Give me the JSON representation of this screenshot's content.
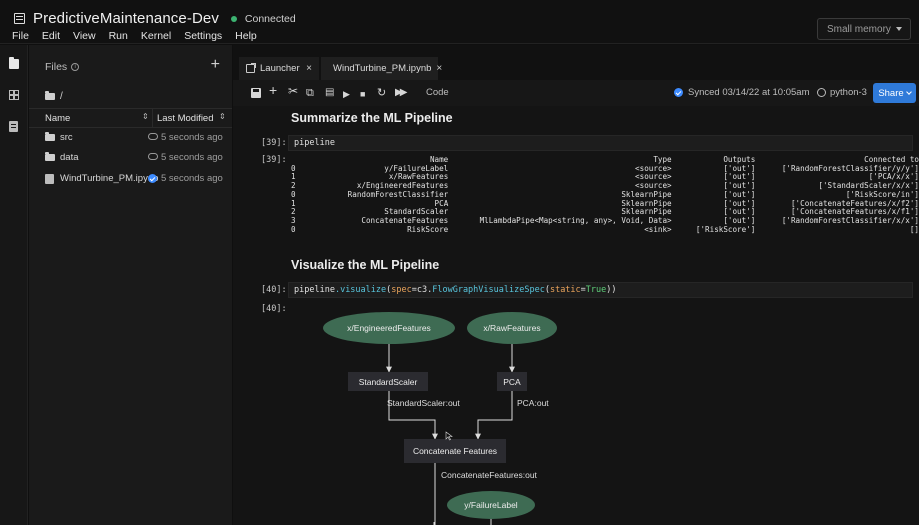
{
  "app": {
    "title": "PredictiveMaintenance-Dev",
    "connection_status": "Connected",
    "menu": [
      "File",
      "Edit",
      "View",
      "Run",
      "Kernel",
      "Settings",
      "Help"
    ],
    "memory_select": "Small memory"
  },
  "file_browser": {
    "title": "Files",
    "path": "/",
    "columns": {
      "name": "Name",
      "modified": "Last Modified"
    },
    "files": [
      {
        "name": "src",
        "type": "folder",
        "modified": "5 seconds ago",
        "status_icon": "cloud-icon"
      },
      {
        "name": "data",
        "type": "folder",
        "modified": "5 seconds ago",
        "status_icon": "cloud-icon"
      },
      {
        "name": "WindTurbine_PM.ipynb",
        "type": "notebook",
        "modified": "5 seconds ago",
        "status_icon": "check-icon"
      }
    ]
  },
  "tabs": [
    {
      "label": "Launcher",
      "icon": "launcher-icon"
    },
    {
      "label": "WindTurbine_PM.ipynb",
      "icon": "notebook-icon"
    }
  ],
  "toolbar": {
    "cell_type": "Code",
    "sync_status": "Synced 03/14/22 at 10:05am",
    "kernel": "python-3",
    "share_label": "Share"
  },
  "notebook": {
    "heading1": "Summarize the ML Pipeline",
    "cell39_prompt": "[39]:",
    "cell39_code": "pipeline",
    "out39_prompt": "[39]:",
    "table": {
      "headers": [
        "",
        "Name",
        "Type",
        "Outputs",
        "Connected to"
      ],
      "rows": [
        [
          "0",
          "y/FailureLabel",
          "<source>",
          "['out']",
          "['RandomForestClassifier/y/y']"
        ],
        [
          "1",
          "x/RawFeatures",
          "<source>",
          "['out']",
          "['PCA/x/x']"
        ],
        [
          "2",
          "x/EngineeredFeatures",
          "<source>",
          "['out']",
          "['StandardScaler/x/x']"
        ],
        [
          "0",
          "RandomForestClassifier",
          "SklearnPipe",
          "['out']",
          "['RiskScore/in']"
        ],
        [
          "1",
          "PCA",
          "SklearnPipe",
          "['out']",
          "['ConcatenateFeatures/x/f2']"
        ],
        [
          "2",
          "StandardScaler",
          "SklearnPipe",
          "['out']",
          "['ConcatenateFeatures/x/f1']"
        ],
        [
          "3",
          "ConcatenateFeatures",
          "MlLambdaPipe<Map<string, any>, Void, Data>",
          "['out']",
          "['RandomForestClassifier/x/x']"
        ],
        [
          "0",
          "RiskScore",
          "<sink>",
          "['RiskScore']",
          "[]"
        ]
      ]
    },
    "heading2": "Visualize the ML Pipeline",
    "cell40_prompt": "[40]:",
    "cell40_code": {
      "p1": "pipeline",
      "p2": ".visualize",
      "p3": "(",
      "p4": "spec",
      "p5": "=c3.",
      "p6": "FlowGraphVisualizeSpec",
      "p7": "(",
      "p8": "static",
      "p9": "=",
      "p10": "True",
      "p11": "))"
    },
    "out40_prompt": "[40]:",
    "graph": {
      "nodes": [
        {
          "id": "engineered",
          "label": "x/EngineeredFeatures",
          "shape": "ellipse"
        },
        {
          "id": "raw",
          "label": "x/RawFeatures",
          "shape": "ellipse"
        },
        {
          "id": "scaler",
          "label": "StandardScaler",
          "shape": "box"
        },
        {
          "id": "pca",
          "label": "PCA",
          "shape": "box"
        },
        {
          "id": "concat",
          "label": "Concatenate Features",
          "shape": "box"
        },
        {
          "id": "failure",
          "label": "y/FailureLabel",
          "shape": "ellipse"
        }
      ],
      "edge_labels": {
        "scaler_out": "StandardScaler:out",
        "pca_out": "PCA:out",
        "concat_out": "ConcatenateFeatures:out"
      },
      "colors": {
        "ellipse": "#3e6b53",
        "box": "#2b2b30",
        "edge": "#dcdcdc"
      }
    }
  }
}
